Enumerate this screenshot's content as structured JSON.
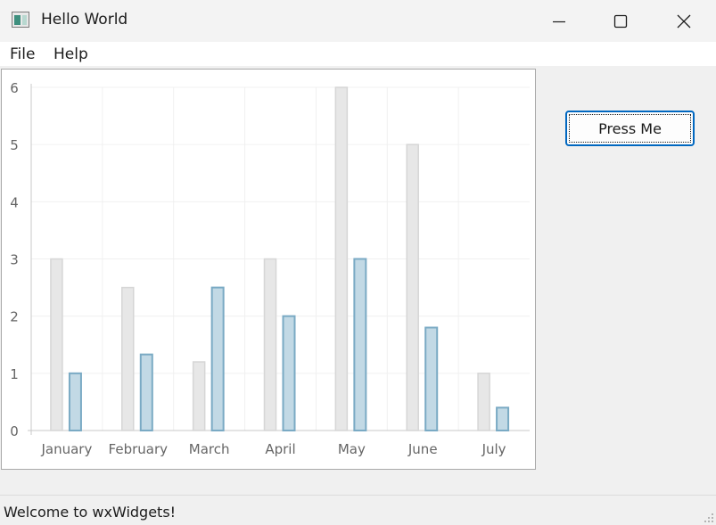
{
  "window": {
    "title": "Hello World"
  },
  "menu": {
    "items": [
      "File",
      "Help"
    ]
  },
  "button": {
    "label": "Press Me"
  },
  "status": {
    "text": "Welcome to wxWidgets!"
  },
  "colors": {
    "series1": "#e7e7e7",
    "series1_stroke": "#d6d6d6",
    "series2": "#c2d9e5",
    "series2_stroke": "#7aaac4",
    "grid": "#f0f0f0",
    "axis": "#c8c8c8",
    "label": "#666666"
  },
  "chart_data": {
    "type": "bar",
    "categories": [
      "January",
      "February",
      "March",
      "April",
      "May",
      "June",
      "July"
    ],
    "series": [
      {
        "values": [
          3,
          2.5,
          1.2,
          3,
          6,
          5,
          1
        ]
      },
      {
        "values": [
          1,
          1.33,
          2.5,
          2,
          3,
          1.8,
          0.4
        ]
      }
    ],
    "ylim": [
      0,
      6
    ],
    "yticks": [
      "0",
      "1",
      "2",
      "3",
      "4",
      "5",
      "6"
    ],
    "grid": true
  }
}
